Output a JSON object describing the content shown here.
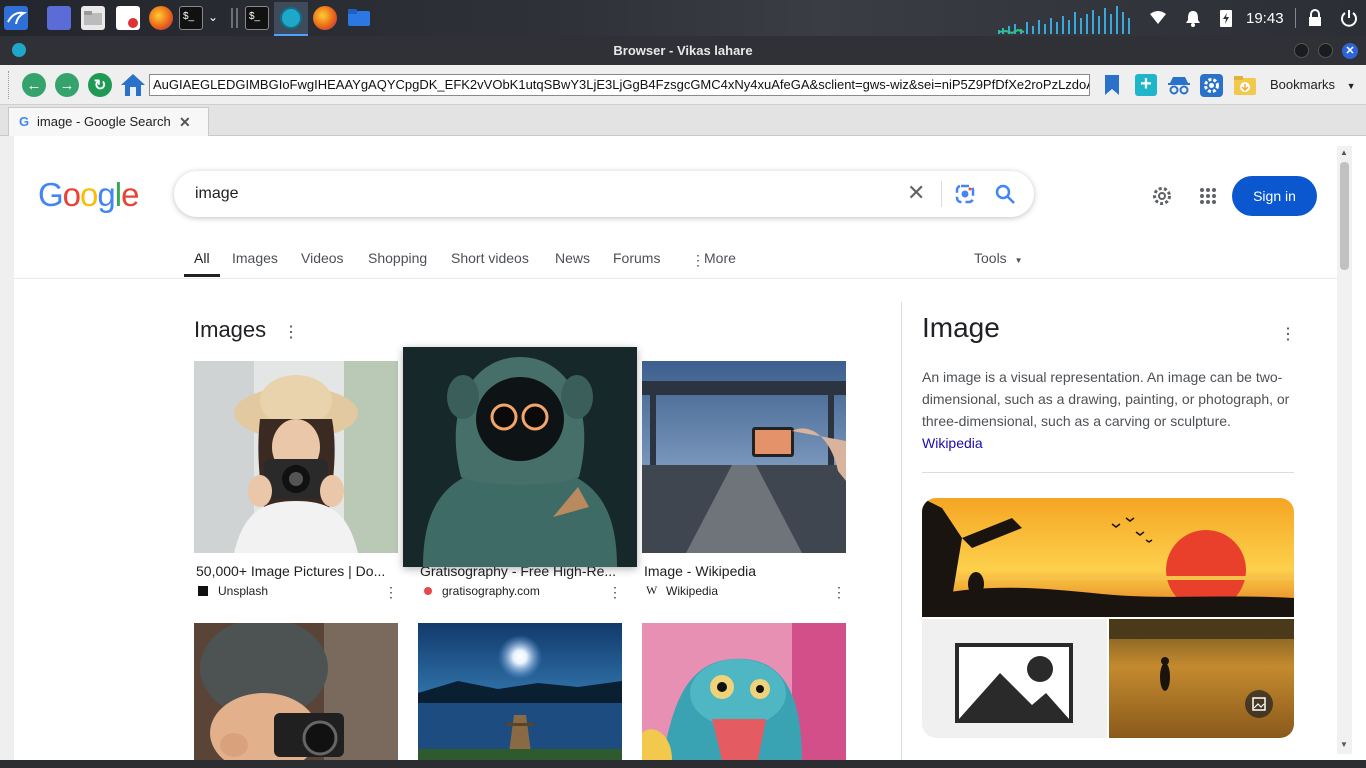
{
  "taskbar": {
    "clock": "19:43"
  },
  "window": {
    "title": "Browser - Vikas lahare"
  },
  "navbar": {
    "url": "AuGIAEGLEDGIMBGIoFwgIHEAAYgAQYCpgDK_EFK2vVObK1utqSBwY3LjE3LjGgB4FzsgcGMC4xNy4xuAfeGA&sclient=gws-wiz&sei=niP5Z9PfDfXe2roPzLzdoAg",
    "bookmarks_label": "Bookmarks"
  },
  "tab": {
    "title": "image - Google Search"
  },
  "google": {
    "logo": "Google",
    "search_value": "image",
    "sign_in": "Sign in",
    "tabs": [
      "All",
      "Images",
      "Videos",
      "Shopping",
      "Short videos",
      "News",
      "Forums",
      "More"
    ],
    "tools": "Tools"
  },
  "images_section": {
    "heading": "Images",
    "results": [
      {
        "title": "50,000+ Image Pictures | Do...",
        "source": "Unsplash"
      },
      {
        "title": "Gratisography - Free High-Re...",
        "source": "gratisography.com"
      },
      {
        "title": "Image - Wikipedia",
        "source": "Wikipedia"
      }
    ]
  },
  "knowledge_panel": {
    "title": "Image",
    "description": "An image is a visual representation. An image can be two-dimensional, such as a drawing, painting, or photograph, or three-dimensional, such as a carving or sculpture.",
    "source_link": "Wikipedia"
  },
  "colors": {
    "accent_blue": "#0b57d0",
    "link": "#1a0dab"
  }
}
